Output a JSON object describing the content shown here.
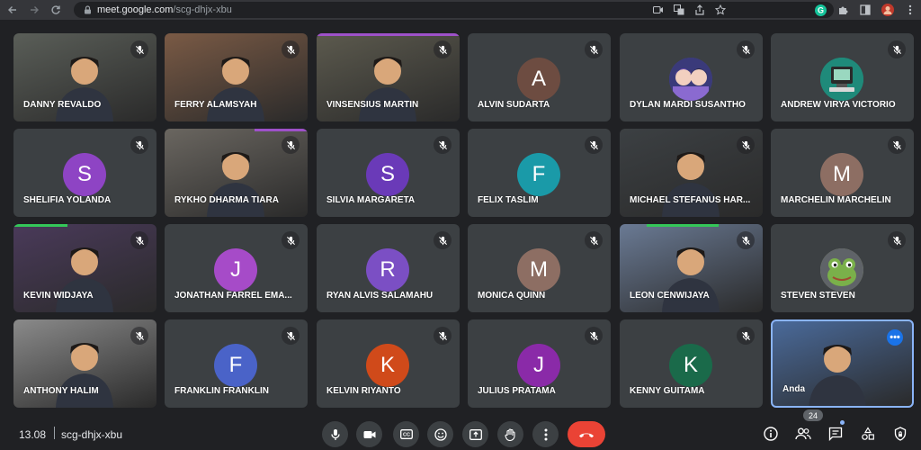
{
  "browser": {
    "url_host": "meet.google.com",
    "url_path": "/scg-dhjx-xbu"
  },
  "participants": [
    {
      "name": "DANNY REVALDO",
      "kind": "video",
      "bg": "#5a5e58"
    },
    {
      "name": "FERRY ALAMSYAH",
      "kind": "video",
      "bg": "#7a5a45"
    },
    {
      "name": "VINSENSIUS MARTIN",
      "kind": "video",
      "bg": "#5c5a4e"
    },
    {
      "name": "ALVIN SUDARTA",
      "kind": "avatar",
      "letter": "A",
      "color": "#6d4c41"
    },
    {
      "name": "DYLAN MARDI SUSANTHO",
      "kind": "avatar-img",
      "icon": "anime-avatar-icon",
      "color": "#4a4a8a"
    },
    {
      "name": "ANDREW VIRYA VICTORIO",
      "kind": "avatar-img",
      "icon": "computer-avatar-icon",
      "color": "#1f8a7a"
    },
    {
      "name": "SHELIFIA YOLANDA",
      "kind": "avatar",
      "letter": "S",
      "color": "#8e44c4"
    },
    {
      "name": "RYKHO DHARMA TIARA",
      "kind": "video",
      "bg": "#6a6660"
    },
    {
      "name": "SILVIA MARGARETA",
      "kind": "avatar",
      "letter": "S",
      "color": "#6a3ab8"
    },
    {
      "name": "FELIX TASLIM",
      "kind": "avatar",
      "letter": "F",
      "color": "#1a9aa8"
    },
    {
      "name": "MICHAEL STEFANUS HAR...",
      "kind": "video",
      "bg": "#3c4043"
    },
    {
      "name": "MARCHELIN MARCHELIN",
      "kind": "avatar",
      "letter": "M",
      "color": "#8d6e63"
    },
    {
      "name": "KEVIN WIDJAYA",
      "kind": "video",
      "bg": "#4a3a5a"
    },
    {
      "name": "JONATHAN FARREL EMA...",
      "kind": "avatar",
      "letter": "J",
      "color": "#a64bc8"
    },
    {
      "name": "RYAN ALVIS SALAMAHU",
      "kind": "avatar",
      "letter": "R",
      "color": "#7b4fc4"
    },
    {
      "name": "MONICA QUINN",
      "kind": "avatar",
      "letter": "M",
      "color": "#8d6e63"
    },
    {
      "name": "LEON CENWIJAYA",
      "kind": "video",
      "bg": "#6a7a94"
    },
    {
      "name": "STEVEN STEVEN",
      "kind": "avatar-img",
      "icon": "frog-avatar-icon",
      "color": "#9aa36a"
    },
    {
      "name": "ANTHONY HALIM",
      "kind": "video",
      "bg": "#8a8a8a"
    },
    {
      "name": "FRANKLIN FRANKLIN",
      "kind": "avatar",
      "letter": "F",
      "color": "#4a63c8"
    },
    {
      "name": "KELVIN RIYANTO",
      "kind": "avatar",
      "letter": "K",
      "color": "#d04a1a"
    },
    {
      "name": "JULIUS PRATAMA",
      "kind": "avatar",
      "letter": "J",
      "color": "#8a2aa8"
    },
    {
      "name": "KENNY GUITAMA",
      "kind": "avatar",
      "letter": "K",
      "color": "#1a6a4a"
    },
    {
      "name": "Anda",
      "kind": "self",
      "bg": "#4a6a9a"
    }
  ],
  "bottom_bar": {
    "time": "13.08",
    "meeting_code": "scg-dhjx-xbu",
    "participant_count": "24",
    "end_call_color": "#ea4335"
  }
}
